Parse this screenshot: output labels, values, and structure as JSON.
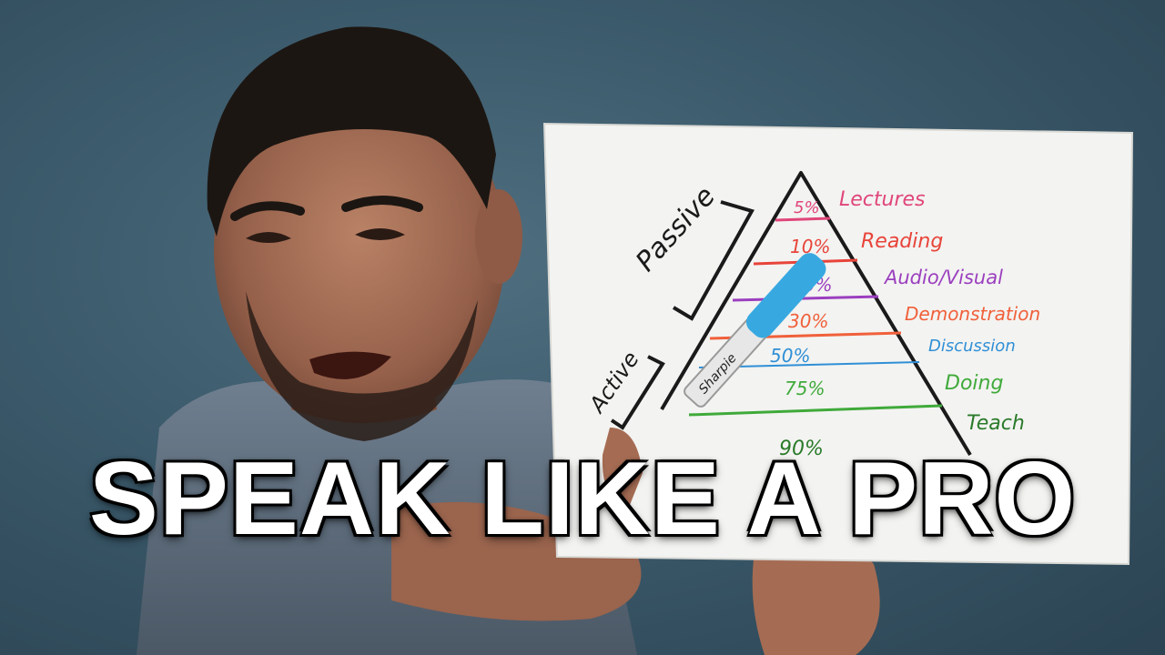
{
  "thumbnail": {
    "title": "SPEAK LIKE A PRO"
  },
  "diagram": {
    "groups": {
      "passive": "Passive",
      "active": "Active"
    },
    "levels": [
      {
        "percent": "5%",
        "label": "Lectures",
        "color": "#e0457a"
      },
      {
        "percent": "10%",
        "label": "Reading",
        "color": "#e8443a"
      },
      {
        "percent": "20%",
        "label": "Audio/Visual",
        "color": "#9b3fbf"
      },
      {
        "percent": "30%",
        "label": "Demonstration",
        "color": "#f0603a"
      },
      {
        "percent": "50%",
        "label": "Discussion",
        "color": "#2f8fd6"
      },
      {
        "percent": "75%",
        "label": "Doing",
        "color": "#3faa3a"
      },
      {
        "percent": "90%",
        "label": "Teach",
        "color": "#2a7a2a"
      }
    ]
  },
  "marker": {
    "brand": "Sharpie",
    "color": "#38a9e0"
  }
}
